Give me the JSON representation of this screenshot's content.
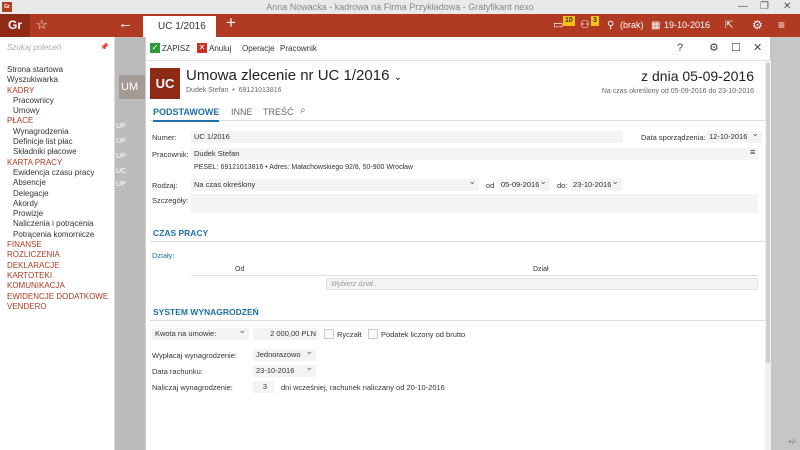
{
  "window": {
    "title": "Anna Nowacka - kadrowa na Firma Przykładowa - Gratyfikant nexo",
    "icon_text": "Gr",
    "minimize": "—",
    "restore": "❐",
    "close": "✕"
  },
  "topbar": {
    "logo": "Gr",
    "active_tab": "UC 1/2016",
    "notif1_count": "10",
    "notif2_count": "3",
    "user_label": "(brak)",
    "date": "19-10-2016"
  },
  "sidebar": {
    "search_placeholder": "Szukaj poleceń",
    "items": [
      {
        "label": "Strona startowa",
        "type": "g"
      },
      {
        "label": "Wyszukiwarka",
        "type": "g"
      },
      {
        "label": "KADRY",
        "type": "sec"
      },
      {
        "label": "Pracownicy",
        "type": "sub"
      },
      {
        "label": "Umowy",
        "type": "sub"
      },
      {
        "label": "PŁACE",
        "type": "sec"
      },
      {
        "label": "Wynagrodzenia",
        "type": "sub"
      },
      {
        "label": "Definicje list płac",
        "type": "sub"
      },
      {
        "label": "Składniki płacowe",
        "type": "sub"
      },
      {
        "label": "KARTA PRACY",
        "type": "sec"
      },
      {
        "label": "Ewidencja czasu pracy",
        "type": "sub"
      },
      {
        "label": "Absencje",
        "type": "sub"
      },
      {
        "label": "Delegacje",
        "type": "sub"
      },
      {
        "label": "Akordy",
        "type": "sub"
      },
      {
        "label": "Prowizje",
        "type": "sub"
      },
      {
        "label": "Naliczenia i potrącenia",
        "type": "sub"
      },
      {
        "label": "Potrącenia komornicze",
        "type": "sub"
      },
      {
        "label": "FINANSE",
        "type": "sec"
      },
      {
        "label": "ROZLICZENIA",
        "type": "sec"
      },
      {
        "label": "DEKLARACJE",
        "type": "sec"
      },
      {
        "label": "KARTOTEKI",
        "type": "sec"
      },
      {
        "label": "KOMUNIKACJA",
        "type": "sec"
      },
      {
        "label": "EWIDENCJE DODATKOWE",
        "type": "sec"
      },
      {
        "label": "VENDERO",
        "type": "sec"
      }
    ]
  },
  "background": {
    "um": "UM",
    "up_rows": [
      "UP",
      "UP",
      "UP",
      "UC",
      "UP"
    ]
  },
  "toolbar": {
    "save": "ZAPISZ",
    "cancel": "Anuluj",
    "operations": "Operacje",
    "employee": "Pracownik"
  },
  "document": {
    "icon_text": "UC",
    "title": "Umowa zlecenie nr UC 1/2016",
    "employee": "Dudek Stefan",
    "pesel": "69121013816",
    "date_title": "z dnia 05-09-2016",
    "period": "Na czas określony od 05-09-2016 do 23-10-2016"
  },
  "tabs": [
    "PODSTAWOWE",
    "INNE",
    "TREŚĆ"
  ],
  "form": {
    "number_label": "Numer:",
    "number_value": "UC 1/2016",
    "date_label": "Data sporządzenia:",
    "date_value": "12-10-2016",
    "employee_label": "Pracownik:",
    "employee_value": "Dudek Stefan",
    "employee_details": "PESEL:  69121013816  •  Adres:  Małachowskiego 92/8, 50-900 Wrocław",
    "type_label": "Rodzaj:",
    "type_value": "Na czas określony",
    "from_label": "od",
    "from_value": "05-09-2016",
    "to_label": "do:",
    "to_value": "23-10-2016",
    "details_label": "Szczegóły:"
  },
  "work_time": {
    "title": "CZAS PRACY",
    "departments_label": "Działy:",
    "col_from": "Od",
    "col_department": "Dział",
    "department_placeholder": "Wybierz dział..."
  },
  "salary": {
    "title": "SYSTEM WYNAGRODZEŃ",
    "amount_type": "Kwota na umowie:",
    "amount_value": "2 000,00 PLN",
    "lump_sum": "Ryczałt",
    "gross_tax": "Podatek liczony od brutto",
    "payout_label": "Wypłacaj wynagrodzenie:",
    "payout_value": "Jednorazowo",
    "bill_date_label": "Data rachunku:",
    "bill_date_value": "23-10-2016",
    "calc_label": "Naliczaj wynagrodzenie:",
    "calc_days": "3",
    "calc_text": "dni wcześniej, rachunek naliczany od 20-10-2016"
  },
  "right_panel": {
    "plusminus": "+/-"
  }
}
